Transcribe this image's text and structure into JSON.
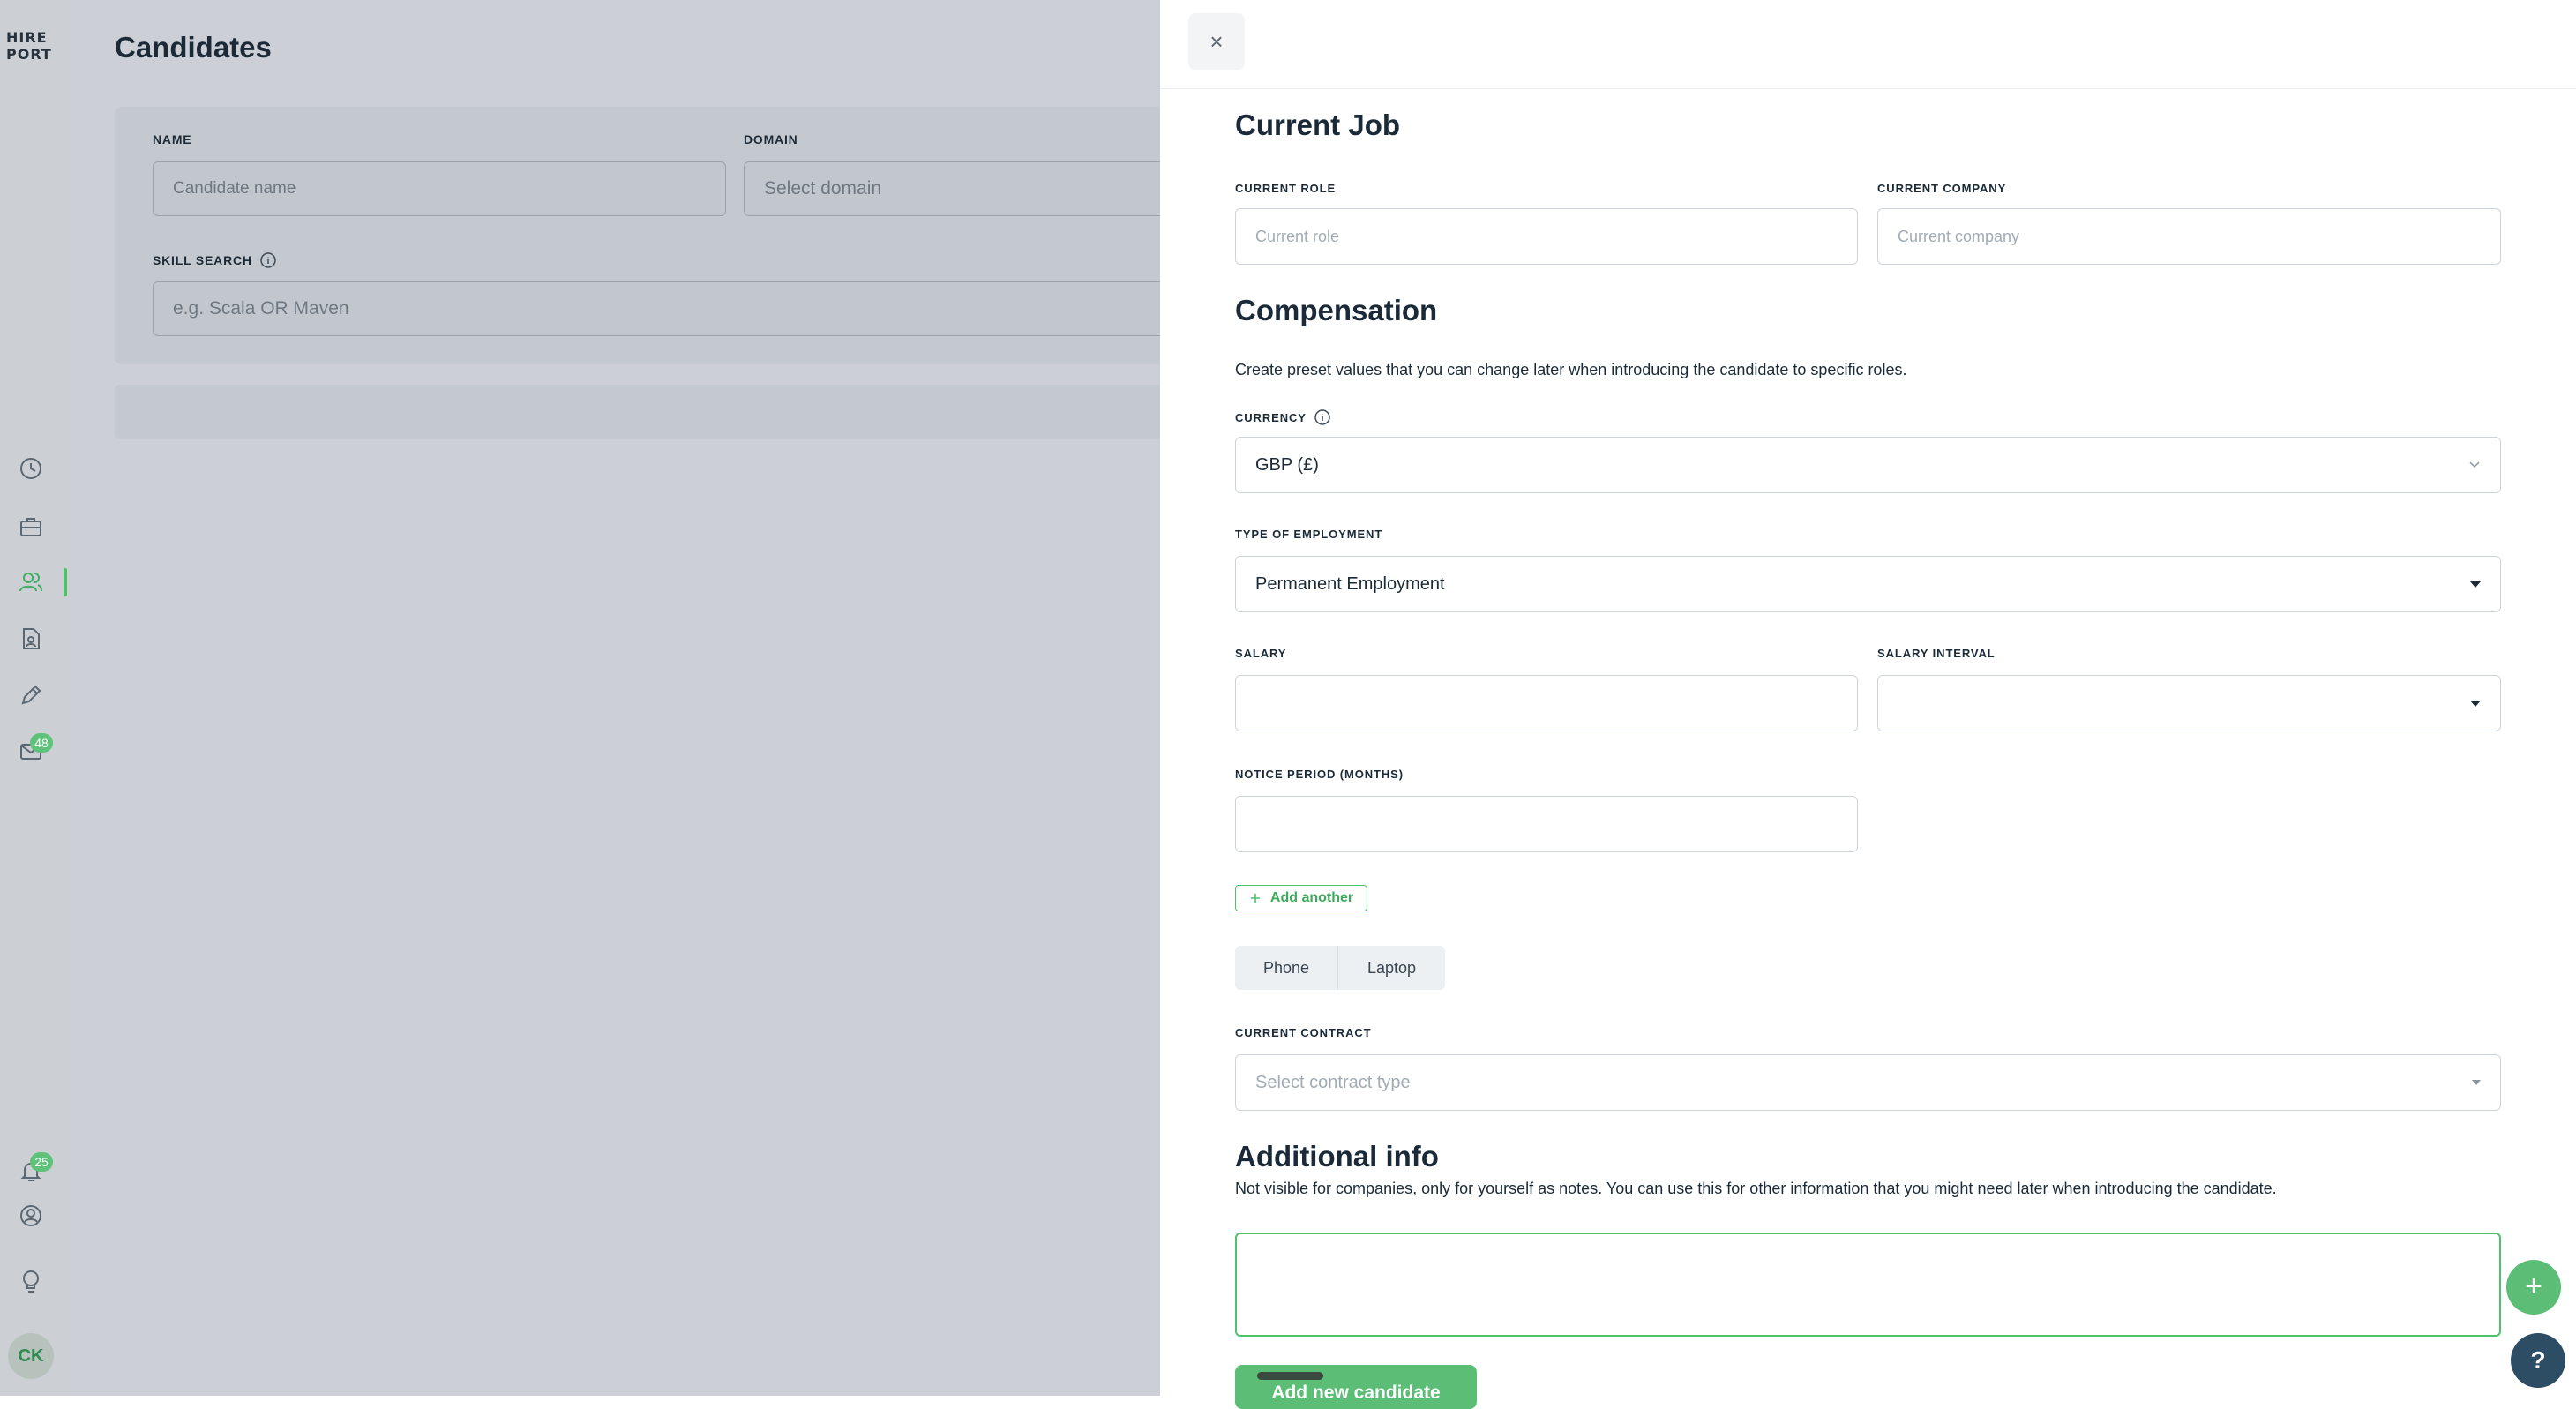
{
  "sidebar": {
    "logo_line1": "HIRE",
    "logo_line2": "PORT",
    "messages_badge": "48",
    "notifications_badge": "25",
    "avatar_initials": "CK"
  },
  "page": {
    "title": "Candidates",
    "filters": {
      "name_label": "NAME",
      "name_placeholder": "Candidate name",
      "domain_label": "DOMAIN",
      "domain_placeholder": "Select domain",
      "skill_label": "SKILL SEARCH",
      "skill_placeholder": "e.g. Scala OR Maven"
    }
  },
  "panel": {
    "close_symbol": "×",
    "current_job": {
      "title": "Current Job",
      "role_label": "CURRENT ROLE",
      "role_placeholder": "Current role",
      "company_label": "CURRENT COMPANY",
      "company_placeholder": "Current company"
    },
    "compensation": {
      "title": "Compensation",
      "description": "Create preset values that you can change later when introducing the candidate to specific roles.",
      "currency_label": "CURRENCY",
      "currency_value": "GBP (£)",
      "employment_label": "TYPE OF EMPLOYMENT",
      "employment_value": "Permanent Employment",
      "salary_label": "SALARY",
      "salary_value": "",
      "salary_interval_label": "SALARY INTERVAL",
      "salary_interval_value": "",
      "notice_label": "NOTICE PERIOD (MONTHS)",
      "notice_value": "",
      "add_another_label": "Add another",
      "equipment_options": [
        "Phone",
        "Laptop"
      ],
      "contract_label": "CURRENT CONTRACT",
      "contract_placeholder": "Select contract type"
    },
    "additional_info": {
      "title": "Additional info",
      "description": "Not visible for companies, only for yourself as notes. You can use this for other information that you might need later when introducing the candidate.",
      "notes_value": ""
    },
    "submit_label": "Add new candidate"
  },
  "floating": {
    "add_symbol": "+",
    "help_symbol": "?"
  },
  "colors": {
    "accent": "#4cc26b",
    "overlay": "#ccd0d6",
    "help_button": "#2c4d63"
  }
}
